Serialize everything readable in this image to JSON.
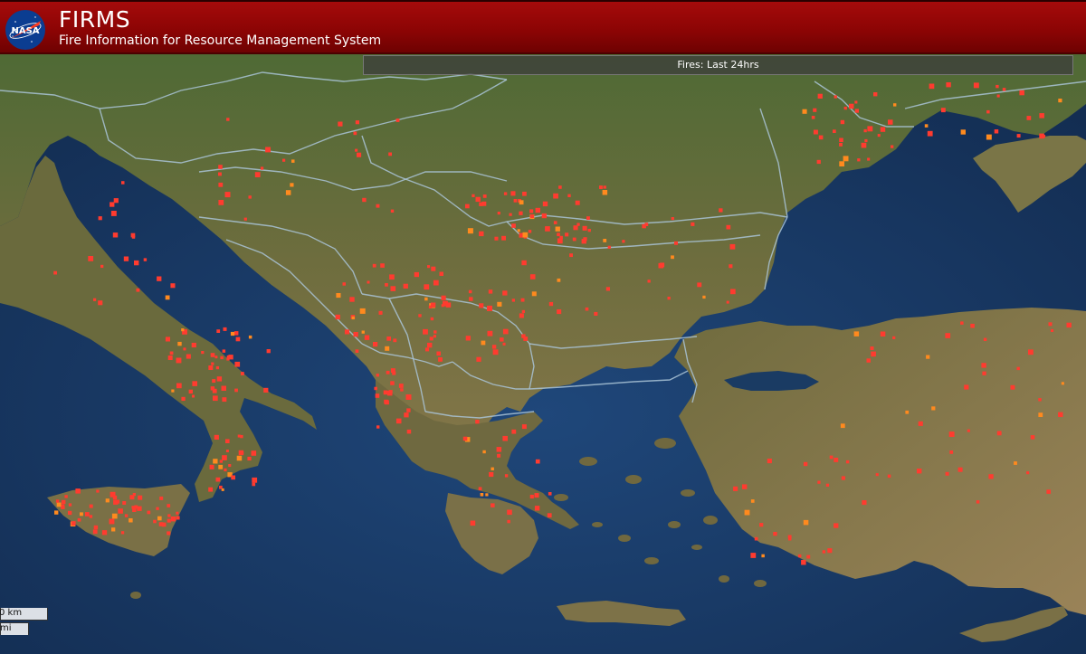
{
  "header": {
    "logo_text": "NASA",
    "title": "FIRMS",
    "subtitle": "Fire Information for Resource Management System"
  },
  "status": {
    "label": "Fires: Last 24hrs"
  },
  "scale": {
    "km_label": "0 km",
    "mi_label": "mi"
  },
  "colors": {
    "header_red": "#8a0404",
    "fire_dot": "#ff3b2f",
    "fire_dot_old": "#ff8a1e",
    "sea": "#1e3f6b",
    "land": "#6b6c3c",
    "border": "#a9c3d6"
  }
}
